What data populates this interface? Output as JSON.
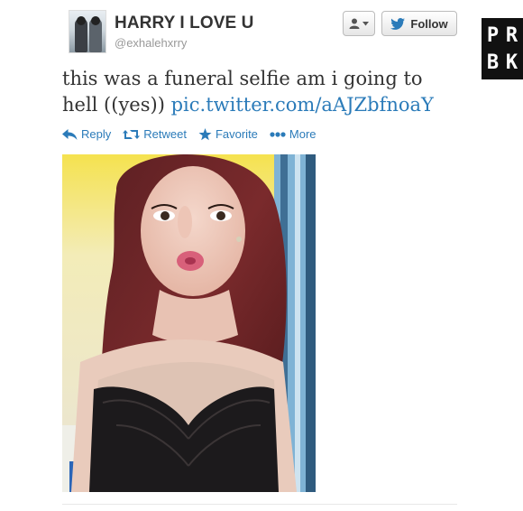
{
  "user": {
    "display_name": "HARRY I LOVE U",
    "screen_name": "@exhalehxrry"
  },
  "buttons": {
    "follow_label": "Follow"
  },
  "tweet": {
    "text": "this was a funeral selfie am i going to hell ((yes))",
    "link": "pic.twitter.com/aAJZbfnoaY"
  },
  "actions": {
    "reply": "Reply",
    "retweet": "Retweet",
    "favorite": "Favorite",
    "more": "More"
  },
  "watermark": {
    "letters": [
      "P",
      "R",
      "B",
      "K"
    ]
  },
  "colors": {
    "link": "#2b7bb9",
    "twitter_bird": "#2b7bb9",
    "watermark_bg": "#111111"
  }
}
